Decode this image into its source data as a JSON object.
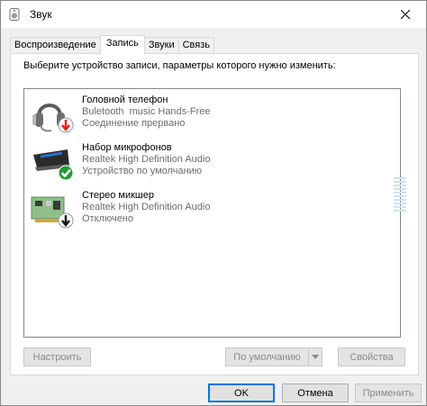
{
  "window": {
    "title": "Звук",
    "title_icon": "speaker-icon",
    "close_icon": "close-icon"
  },
  "tabs": [
    {
      "label": "Воспроизведение",
      "active": false
    },
    {
      "label": "Запись",
      "active": true
    },
    {
      "label": "Звуки",
      "active": false
    },
    {
      "label": "Связь",
      "active": false
    }
  ],
  "panel": {
    "hint": "Выберите устройство записи, параметры которого нужно изменить:"
  },
  "devices": [
    {
      "name": "Головной телефон",
      "driver": "Buletooth  music Hands-Free",
      "state": "Соединение прервано",
      "icon": "headset-icon",
      "badge": "disconnected-down-arrow-icon"
    },
    {
      "name": "Набор микрофонов",
      "driver": "Realtek High Definition Audio",
      "state": "Устройство по умолчанию",
      "icon": "microphone-array-icon",
      "badge": "default-checkmark-icon"
    },
    {
      "name": "Стерео микшер",
      "driver": "Realtek High Definition Audio",
      "state": "Отключено",
      "icon": "sound-card-icon",
      "badge": "disabled-down-arrow-icon"
    }
  ],
  "buttons": {
    "configure": "Настроить",
    "set_default": "По умолчанию",
    "properties": "Свойства",
    "ok": "OK",
    "cancel": "Отмена",
    "apply": "Применить"
  },
  "colors": {
    "accent": "#0078d7",
    "badge_red": "#e0261c",
    "badge_green": "#1f9b2f",
    "level_meter": "#cfe3f1"
  }
}
